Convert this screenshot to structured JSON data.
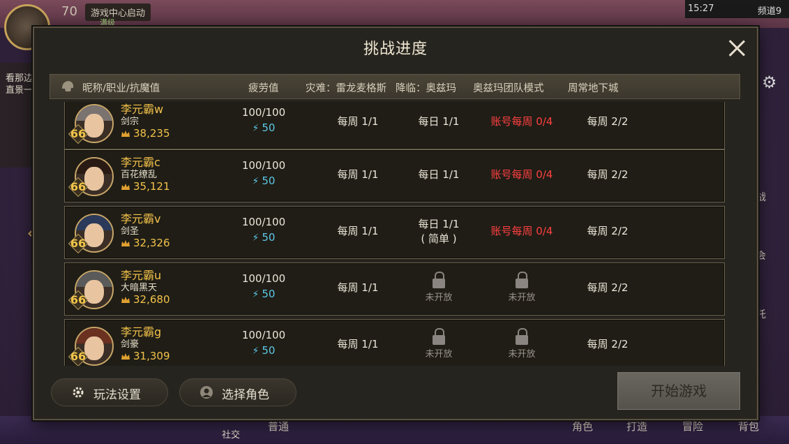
{
  "background": {
    "level": "70",
    "game_center_label": "游戏中心启动",
    "level_badge": "满级",
    "status_time": "15:27",
    "channel": "频道9",
    "left_text": [
      "看那边",
      "直景一"
    ],
    "bottom_labels": [
      "社交",
      "普通",
      "角色",
      "打造",
      "冒险",
      "背包"
    ],
    "right_labels": [
      "战",
      "会",
      "托"
    ]
  },
  "dialog": {
    "title": "挑战进度",
    "headers": {
      "name": "昵称/职业/抗魔值",
      "fatigue": "疲劳值",
      "calamity": "灾难：雷龙麦格斯",
      "descent": "降临：奥兹玛",
      "raid": "奥兹玛团队模式",
      "weekly": "周常地下城"
    },
    "rows": [
      {
        "name": "李元霸w",
        "job": "剑宗",
        "power": "38,235",
        "level": "66",
        "fatigue": "100/100",
        "energy": "50",
        "calamity": "每周 1/1",
        "descent": "每日 1/1",
        "descent_sub": "",
        "raid": "账号每周 0/4",
        "raid_locked": false,
        "weekly": "每周 2/2",
        "descent_locked": false
      },
      {
        "name": "李元霸c",
        "job": "百花缭乱",
        "power": "35,121",
        "level": "66",
        "fatigue": "100/100",
        "energy": "50",
        "calamity": "每周 1/1",
        "descent": "每日 1/1",
        "descent_sub": "",
        "raid": "账号每周 0/4",
        "raid_locked": false,
        "weekly": "每周 2/2",
        "descent_locked": false
      },
      {
        "name": "李元霸v",
        "job": "剑圣",
        "power": "32,326",
        "level": "66",
        "fatigue": "100/100",
        "energy": "50",
        "calamity": "每周 1/1",
        "descent": "每日 1/1",
        "descent_sub": "( 简单 )",
        "raid": "账号每周 0/4",
        "raid_locked": false,
        "weekly": "每周 2/2",
        "descent_locked": false
      },
      {
        "name": "李元霸u",
        "job": "大暗黑天",
        "power": "32,680",
        "level": "66",
        "fatigue": "100/100",
        "energy": "50",
        "calamity": "每周 1/1",
        "descent": "未开放",
        "descent_sub": "",
        "raid": "未开放",
        "raid_locked": true,
        "weekly": "每周 2/2",
        "descent_locked": true
      },
      {
        "name": "李元霸g",
        "job": "剑豪",
        "power": "31,309",
        "level": "66",
        "fatigue": "100/100",
        "energy": "50",
        "calamity": "每周 1/1",
        "descent": "未开放",
        "descent_sub": "",
        "raid": "未开放",
        "raid_locked": true,
        "weekly": "每周 2/2",
        "descent_locked": true
      }
    ],
    "buttons": {
      "settings": "玩法设置",
      "select_role": "选择角色",
      "start": "开始游戏"
    }
  },
  "colors": {
    "gold": "#f3c24a",
    "red": "#ff4040",
    "energy": "#5ec8e6"
  }
}
